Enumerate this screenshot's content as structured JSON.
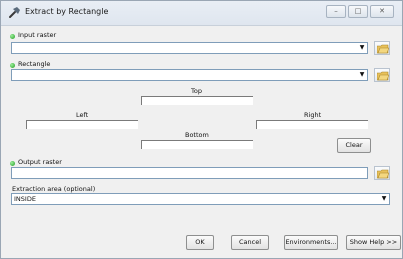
{
  "window": {
    "title": "Extract by Rectangle",
    "controls": {
      "minimize": "–",
      "maximize": "□",
      "close": "✕"
    }
  },
  "form": {
    "input_raster": {
      "label": "Input raster",
      "value": "",
      "required": true
    },
    "rectangle": {
      "label": "Rectangle",
      "value": "",
      "required": true
    },
    "extent": {
      "top_label": "Top",
      "left_label": "Left",
      "right_label": "Right",
      "bottom_label": "Bottom",
      "clear_label": "Clear"
    },
    "output_raster": {
      "label": "Output raster",
      "value": "",
      "required": true
    },
    "extraction_area": {
      "label": "Extraction area (optional)",
      "value": "INSIDE"
    }
  },
  "footer": {
    "ok_label": "OK",
    "cancel_label": "Cancel",
    "environments_label": "Environments...",
    "help_label": "Show Help >>"
  },
  "icons": {
    "title": "hammer-icon",
    "required": "green-dot-icon",
    "browse": "open-folder-icon",
    "dropdown": "chevron-down-icon"
  },
  "colors": {
    "window_bg": "#f0f0f0",
    "field_border": "#7f9db9",
    "required_dot": "#1c9a1c",
    "folder": "#e8c15a"
  }
}
